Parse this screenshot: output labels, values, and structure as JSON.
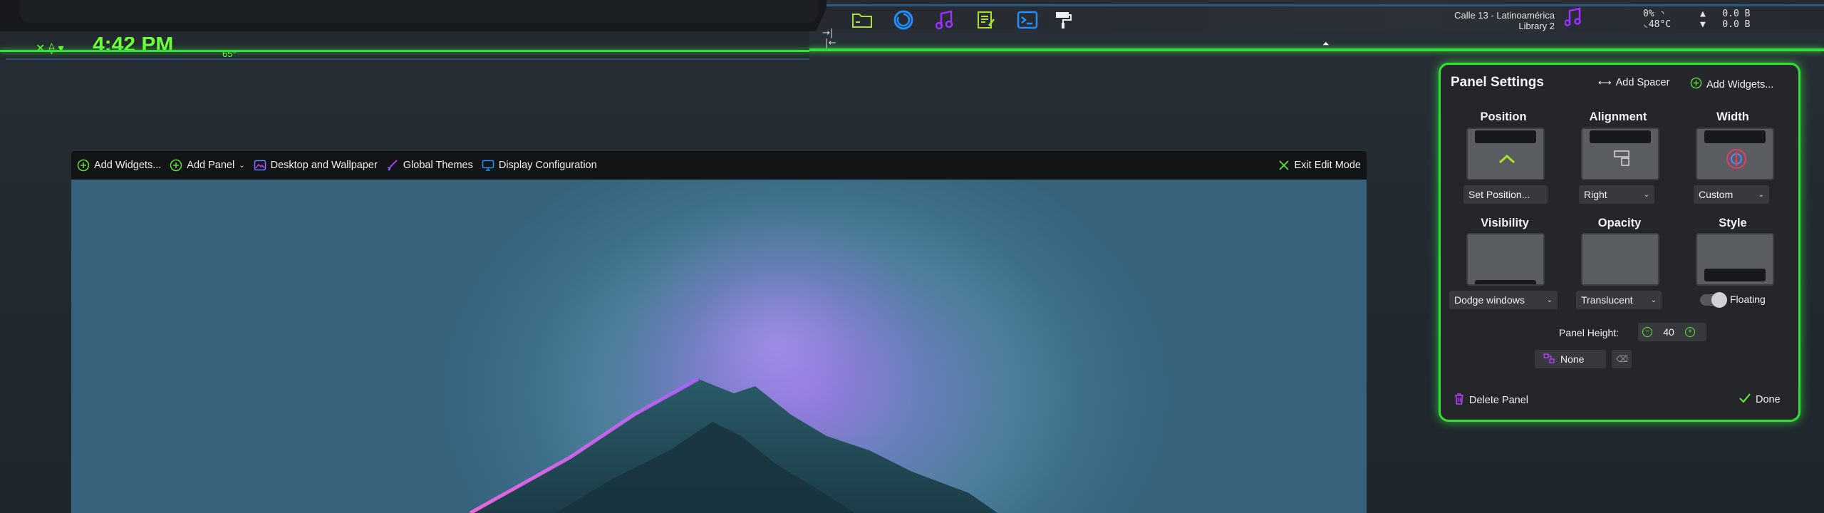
{
  "top_panel": {
    "clock_time": "4:42 PM",
    "clock_temp": "65°",
    "media_title": "Calle 13 - Latinoamérica",
    "media_subtitle": "Library 2",
    "cpu_percent": "0%",
    "cpu_temp": "48°C",
    "net_up": "0.0 B",
    "net_down": "0.0 B",
    "launchers": [
      "folder-icon",
      "browser-icon",
      "music-icon",
      "text-editor-icon",
      "terminal-icon",
      "paint-roller-icon"
    ],
    "colors": {
      "accent_green": "#33e03a",
      "panel_blue": "#2c5a86"
    }
  },
  "edit_toolbar": {
    "add_widgets": "Add Widgets...",
    "add_panel": "Add Panel",
    "desktop_wallpaper": "Desktop and Wallpaper",
    "global_themes": "Global Themes",
    "display_configuration": "Display Configuration",
    "exit_edit_mode": "Exit Edit Mode"
  },
  "panel_settings": {
    "title": "Panel Settings",
    "add_spacer": "Add Spacer",
    "add_widgets": "Add Widgets...",
    "position_label": "Position",
    "position_button": "Set Position...",
    "alignment_label": "Alignment",
    "alignment_value": "Right",
    "width_label": "Width",
    "width_value": "Custom",
    "visibility_label": "Visibility",
    "visibility_value": "Dodge windows",
    "opacity_label": "Opacity",
    "opacity_value": "Translucent",
    "style_label": "Style",
    "floating_label": "Floating",
    "panel_height_label": "Panel Height:",
    "panel_height_value": "40",
    "shortcut_value": "None",
    "delete_panel": "Delete Panel",
    "done": "Done"
  }
}
